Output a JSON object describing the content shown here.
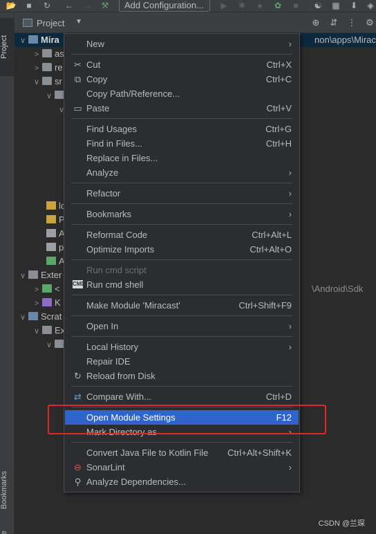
{
  "toolbar": {
    "add_configuration": "Add Configuration..."
  },
  "left_stripe": {
    "project_tab": "Project",
    "bookmarks_tab": "Bookmarks",
    "structure_tab": "ure"
  },
  "project_panel": {
    "title": "Project",
    "path_hint_root": "non\\apps\\Miracast",
    "path_hint_sdk": "\\Android\\Sdk",
    "tree": [
      {
        "label": "Mira",
        "depth": 0,
        "arrow": "v"
      },
      {
        "label": "as",
        "depth": 1,
        "arrow": ">"
      },
      {
        "label": "re",
        "depth": 1,
        "arrow": ">"
      },
      {
        "label": "sr",
        "depth": 1,
        "arrow": "v"
      },
      {
        "label": "",
        "depth": 2,
        "arrow": "v"
      },
      {
        "label": "",
        "depth": 3,
        "arrow": "v"
      },
      {
        "label": "lc",
        "depth": 2,
        "arrow": ""
      },
      {
        "label": "P",
        "depth": 2,
        "arrow": ""
      },
      {
        "label": "A",
        "depth": 2,
        "arrow": ""
      },
      {
        "label": "p",
        "depth": 2,
        "arrow": ""
      },
      {
        "label": "A",
        "depth": 2,
        "arrow": ""
      },
      {
        "label": "Exter",
        "depth": 0,
        "arrow": "v"
      },
      {
        "label": "<",
        "depth": 1,
        "arrow": ">"
      },
      {
        "label": "K",
        "depth": 1,
        "arrow": ">"
      },
      {
        "label": "Scrat",
        "depth": 0,
        "arrow": "v"
      },
      {
        "label": "Ex",
        "depth": 1,
        "arrow": "v"
      },
      {
        "label": "",
        "depth": 2,
        "arrow": "v"
      }
    ]
  },
  "context_menu": {
    "items": [
      {
        "label": "New",
        "shortcut": "",
        "submenu": true,
        "icon": "",
        "disabled": false,
        "highlight": false
      },
      {
        "label": "Cut",
        "shortcut": "Ctrl+X",
        "submenu": false,
        "icon": "scissors-icon",
        "disabled": false,
        "highlight": false
      },
      {
        "label": "Copy",
        "shortcut": "Ctrl+C",
        "submenu": false,
        "icon": "copy-icon",
        "disabled": false,
        "highlight": false
      },
      {
        "label": "Copy Path/Reference...",
        "shortcut": "",
        "submenu": false,
        "icon": "",
        "disabled": false,
        "highlight": false
      },
      {
        "label": "Paste",
        "shortcut": "Ctrl+V",
        "submenu": false,
        "icon": "clipboard-icon",
        "disabled": false,
        "highlight": false
      },
      {
        "label": "Find Usages",
        "shortcut": "Ctrl+G",
        "submenu": false,
        "icon": "",
        "disabled": false,
        "highlight": false
      },
      {
        "label": "Find in Files...",
        "shortcut": "Ctrl+H",
        "submenu": false,
        "icon": "",
        "disabled": false,
        "highlight": false
      },
      {
        "label": "Replace in Files...",
        "shortcut": "",
        "submenu": false,
        "icon": "",
        "disabled": false,
        "highlight": false
      },
      {
        "label": "Analyze",
        "shortcut": "",
        "submenu": true,
        "icon": "",
        "disabled": false,
        "highlight": false
      },
      {
        "label": "Refactor",
        "shortcut": "",
        "submenu": true,
        "icon": "",
        "disabled": false,
        "highlight": false
      },
      {
        "label": "Bookmarks",
        "shortcut": "",
        "submenu": true,
        "icon": "",
        "disabled": false,
        "highlight": false
      },
      {
        "label": "Reformat Code",
        "shortcut": "Ctrl+Alt+L",
        "submenu": false,
        "icon": "",
        "disabled": false,
        "highlight": false
      },
      {
        "label": "Optimize Imports",
        "shortcut": "Ctrl+Alt+O",
        "submenu": false,
        "icon": "",
        "disabled": false,
        "highlight": false
      },
      {
        "label": "Run cmd script",
        "shortcut": "",
        "submenu": false,
        "icon": "",
        "disabled": true,
        "highlight": false
      },
      {
        "label": "Run cmd shell",
        "shortcut": "",
        "submenu": false,
        "icon": "cmd-icon",
        "disabled": false,
        "highlight": false
      },
      {
        "label": "Make Module 'Miracast'",
        "shortcut": "Ctrl+Shift+F9",
        "submenu": false,
        "icon": "",
        "disabled": false,
        "highlight": false
      },
      {
        "label": "Open In",
        "shortcut": "",
        "submenu": true,
        "icon": "",
        "disabled": false,
        "highlight": false
      },
      {
        "label": "Local History",
        "shortcut": "",
        "submenu": true,
        "icon": "",
        "disabled": false,
        "highlight": false
      },
      {
        "label": "Repair IDE",
        "shortcut": "",
        "submenu": false,
        "icon": "",
        "disabled": false,
        "highlight": false
      },
      {
        "label": "Reload from Disk",
        "shortcut": "",
        "submenu": false,
        "icon": "reload-icon",
        "disabled": false,
        "highlight": false
      },
      {
        "label": "Compare With...",
        "shortcut": "Ctrl+D",
        "submenu": false,
        "icon": "compare-icon",
        "disabled": false,
        "highlight": false
      },
      {
        "label": "Open Module Settings",
        "shortcut": "F12",
        "submenu": false,
        "icon": "",
        "disabled": false,
        "highlight": true
      },
      {
        "label": "Mark Directory as",
        "shortcut": "",
        "submenu": true,
        "icon": "",
        "disabled": false,
        "highlight": false
      },
      {
        "label": "Convert Java File to Kotlin File",
        "shortcut": "Ctrl+Alt+Shift+K",
        "submenu": false,
        "icon": "",
        "disabled": false,
        "highlight": false
      },
      {
        "label": "SonarLint",
        "shortcut": "",
        "submenu": true,
        "icon": "sonarlint-icon",
        "disabled": false,
        "highlight": false
      },
      {
        "label": "Analyze Dependencies...",
        "shortcut": "",
        "submenu": false,
        "icon": "analyze-icon",
        "disabled": false,
        "highlight": false
      }
    ]
  },
  "colors": {
    "highlight": "#2f65ca",
    "annotation_red": "#e32626"
  },
  "watermark": "CSDN @兰琛"
}
